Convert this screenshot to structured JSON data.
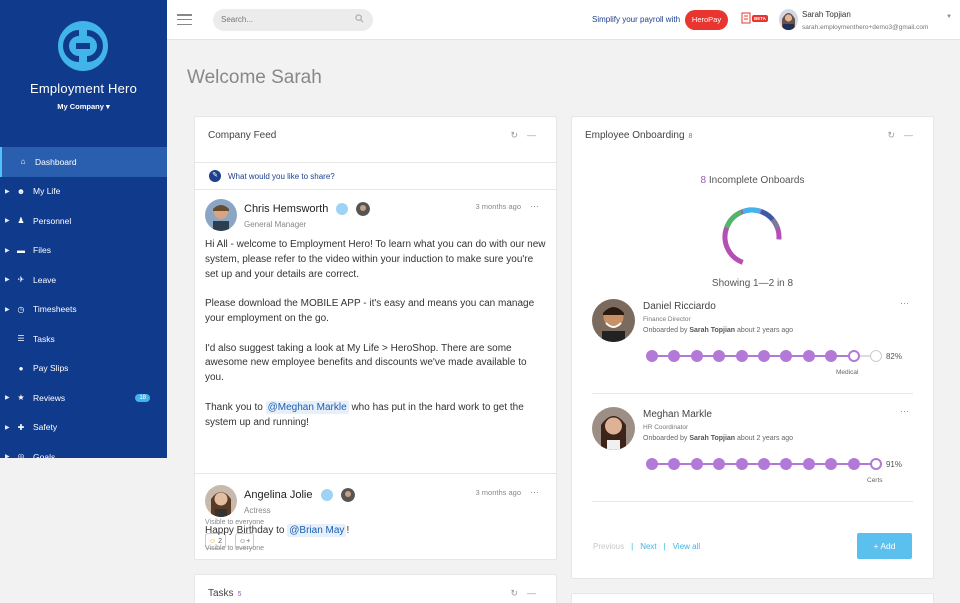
{
  "sidebar": {
    "brand": "Employment Hero",
    "company": "My Company ▾",
    "items": [
      {
        "label": "Dashboard",
        "icon": "home-icon",
        "glyph": "⌂",
        "caret": ""
      },
      {
        "label": "My Life",
        "icon": "smile-icon",
        "glyph": "☻",
        "caret": "▶"
      },
      {
        "label": "Personnel",
        "icon": "people-icon",
        "glyph": "♟",
        "caret": "▶"
      },
      {
        "label": "Files",
        "icon": "folder-icon",
        "glyph": "▬",
        "caret": "▶"
      },
      {
        "label": "Leave",
        "icon": "plane-icon",
        "glyph": "✈",
        "caret": "▶"
      },
      {
        "label": "Timesheets",
        "icon": "stopwatch-icon",
        "glyph": "◷",
        "caret": "▶"
      },
      {
        "label": "Tasks",
        "icon": "list-icon",
        "glyph": "☰",
        "caret": ""
      },
      {
        "label": "Pay Slips",
        "icon": "dollar-icon",
        "glyph": "●",
        "caret": ""
      },
      {
        "label": "Reviews",
        "icon": "star-icon",
        "glyph": "★",
        "caret": "▶",
        "badge": "18"
      },
      {
        "label": "Safety",
        "icon": "first-aid-icon",
        "glyph": "✚",
        "caret": "▶"
      },
      {
        "label": "Goals",
        "icon": "target-icon",
        "glyph": "◎",
        "caret": "▶"
      }
    ]
  },
  "topbar": {
    "search_placeholder": "Search...",
    "promo": "Simplify your payroll with",
    "heropay": "HeroPay",
    "beta": "BETA",
    "user_name": "Sarah Topjian",
    "user_email": "sarah.employmenthero+demo3@gmail.com"
  },
  "welcome": "Welcome Sarah",
  "feed": {
    "title": "Company Feed",
    "share_prompt": "What would you like to share?",
    "posts": [
      {
        "name": "Chris Hemsworth",
        "role": "General Manager",
        "time": "3 months ago",
        "paragraphs": [
          "Hi All - welcome to Employment Hero! To learn what you can do with our new system, please refer to the video within your induction to make sure you're set up and your details are correct.",
          "Please download the MOBILE APP - it's easy and means you can manage your employment on the go.",
          "I'd also suggest taking a look at My Life > HeroShop. There are some awesome new employee benefits and discounts we've made available to you."
        ],
        "thanks_before": "Thank you to ",
        "mention": "@Meghan Markle",
        "thanks_after": " who has put in the hard work to get the system up and running!",
        "visibility": "Visible to everyone",
        "reaction_count": "2"
      },
      {
        "name": "Angelina Jolie",
        "role": "Actress",
        "time": "3 months ago",
        "text_before": "Happy Birthday to ",
        "mention": "@Brian May",
        "text_after": "!",
        "visibility": "Visible to everyone"
      }
    ]
  },
  "tasks": {
    "title": "Tasks",
    "count": "5"
  },
  "onboarding": {
    "title": "Employee Onboarding",
    "count": "8",
    "summary_num": "8",
    "summary_text": " Incomplete Onboards",
    "showing": "Showing 1—2 in  8",
    "items": [
      {
        "name": "Daniel Ricciardo",
        "role": "Finance Director",
        "by_prefix": "Onboarded by ",
        "by_name": "Sarah Topjian",
        "by_suffix": " about 2 years ago",
        "percent": "82%",
        "step": "Medical",
        "done": 9,
        "total": 11
      },
      {
        "name": "Meghan Markle",
        "role": "HR Coordinator",
        "by_prefix": "Onboarded by ",
        "by_name": "Sarah Topjian",
        "by_suffix": " about 2 years ago",
        "percent": "91%",
        "step": "Certs",
        "done": 10,
        "total": 11
      }
    ],
    "pager": {
      "previous": "Previous",
      "next": "Next",
      "view_all": "View all"
    },
    "add": "+ Add"
  },
  "colors": {
    "sidebar": "#103a8c",
    "accent": "#9b59b6",
    "link": "#41b4e9",
    "heropay": "#e8352f"
  }
}
